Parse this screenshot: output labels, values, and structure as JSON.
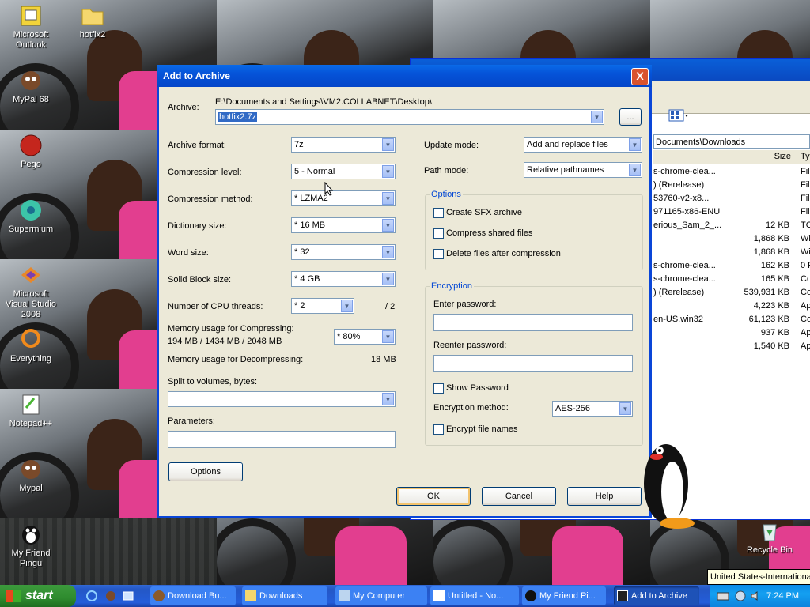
{
  "desktop": {
    "icons": [
      {
        "label": "Microsoft Outlook",
        "icon": "outlook-icon"
      },
      {
        "label": "hotfix2",
        "icon": "folder-icon"
      },
      {
        "label": "MyPal 68",
        "icon": "mypal-icon"
      },
      {
        "label": "Pego",
        "icon": "pego-icon"
      },
      {
        "label": "Supermium",
        "icon": "supermium-icon"
      },
      {
        "label": "Microsoft Visual Studio 2008",
        "icon": "visual-studio-icon"
      },
      {
        "label": "Everything",
        "icon": "everything-icon"
      },
      {
        "label": "Notepad++",
        "icon": "notepadpp-icon"
      },
      {
        "label": "Mypal",
        "icon": "mypal-icon"
      },
      {
        "label": "My Friend Pingu",
        "icon": "pingu-icon"
      },
      {
        "label": "Recycle Bin",
        "icon": "recycle-bin-icon"
      }
    ]
  },
  "explorer": {
    "address": "Documents\\Downloads",
    "columns": {
      "size": "Size",
      "type": "Ty"
    },
    "rows": [
      {
        "name": "s-chrome-clea...",
        "size": "",
        "type": "File"
      },
      {
        "name": ") (Rerelease)",
        "size": "",
        "type": "File"
      },
      {
        "name": "53760-v2-x8...",
        "size": "",
        "type": "File"
      },
      {
        "name": "971165-x86-ENU",
        "size": "",
        "type": "File"
      },
      {
        "name": "erious_Sam_2_...",
        "size": "12 KB",
        "type": "TC"
      },
      {
        "name": "",
        "size": "1,868 KB",
        "type": "Wi"
      },
      {
        "name": "",
        "size": "1,868 KB",
        "type": "Wi"
      },
      {
        "name": "s-chrome-clea...",
        "size": "162 KB",
        "type": "0 F"
      },
      {
        "name": "s-chrome-clea...",
        "size": "165 KB",
        "type": "Co"
      },
      {
        "name": ") (Rerelease)",
        "size": "539,931 KB",
        "type": "Co"
      },
      {
        "name": "",
        "size": "4,223 KB",
        "type": "Ap"
      },
      {
        "name": "en-US.win32",
        "size": "61,123 KB",
        "type": "Co"
      },
      {
        "name": "",
        "size": "937 KB",
        "type": "Ap"
      },
      {
        "name": "",
        "size": "1,540 KB",
        "type": "Ap"
      }
    ]
  },
  "dialog": {
    "title": "Add to Archive",
    "close": "X",
    "archive_label": "Archive:",
    "archive_path": "E:\\Documents and Settings\\VM2.COLLABNET\\Desktop\\",
    "archive_name": "hotfix2.7z",
    "browse": "...",
    "format_label": "Archive format:",
    "format_value": "7z",
    "level_label": "Compression level:",
    "level_value": "5 - Normal",
    "method_label": "Compression method:",
    "method_value": "* LZMA2",
    "dict_label": "Dictionary size:",
    "dict_value": "* 16 MB",
    "word_label": "Word size:",
    "word_value": "* 32",
    "solid_label": "Solid Block size:",
    "solid_value": "* 4 GB",
    "threads_label": "Number of CPU threads:",
    "threads_value": "* 2",
    "threads_max": "/ 2",
    "mem_comp_label": "Memory usage for Compressing:",
    "mem_comp_value": "194 MB / 1434 MB / 2048 MB",
    "mem_comp_pct": "* 80%",
    "mem_decomp_label": "Memory usage for Decompressing:",
    "mem_decomp_value": "18 MB",
    "split_label": "Split to volumes, bytes:",
    "split_value": "",
    "params_label": "Parameters:",
    "params_value": "",
    "options_button": "Options",
    "update_label": "Update mode:",
    "update_value": "Add and replace files",
    "path_label": "Path mode:",
    "path_value": "Relative pathnames",
    "options_group": "Options",
    "opt_sfx": "Create SFX archive",
    "opt_shared": "Compress shared files",
    "opt_delete": "Delete files after compression",
    "enc_group": "Encryption",
    "enter_pw": "Enter password:",
    "reenter_pw": "Reenter password:",
    "show_pw": "Show Password",
    "enc_method_label": "Encryption method:",
    "enc_method_value": "AES-256",
    "enc_names": "Encrypt file names",
    "ok": "OK",
    "cancel": "Cancel",
    "help": "Help"
  },
  "taskbar": {
    "start": "start",
    "tasks": [
      "Download Bu...",
      "Downloads",
      "My Computer",
      "Untitled - No...",
      "My Friend Pi...",
      "Add to Archive"
    ],
    "clock": "7:24 PM",
    "tooltip": "United States-International"
  },
  "colors": {
    "title_blue": "#0553d8",
    "dialog_face": "#ece9d8",
    "start_green": "#2e8b2e",
    "selection": "#316ac5"
  }
}
